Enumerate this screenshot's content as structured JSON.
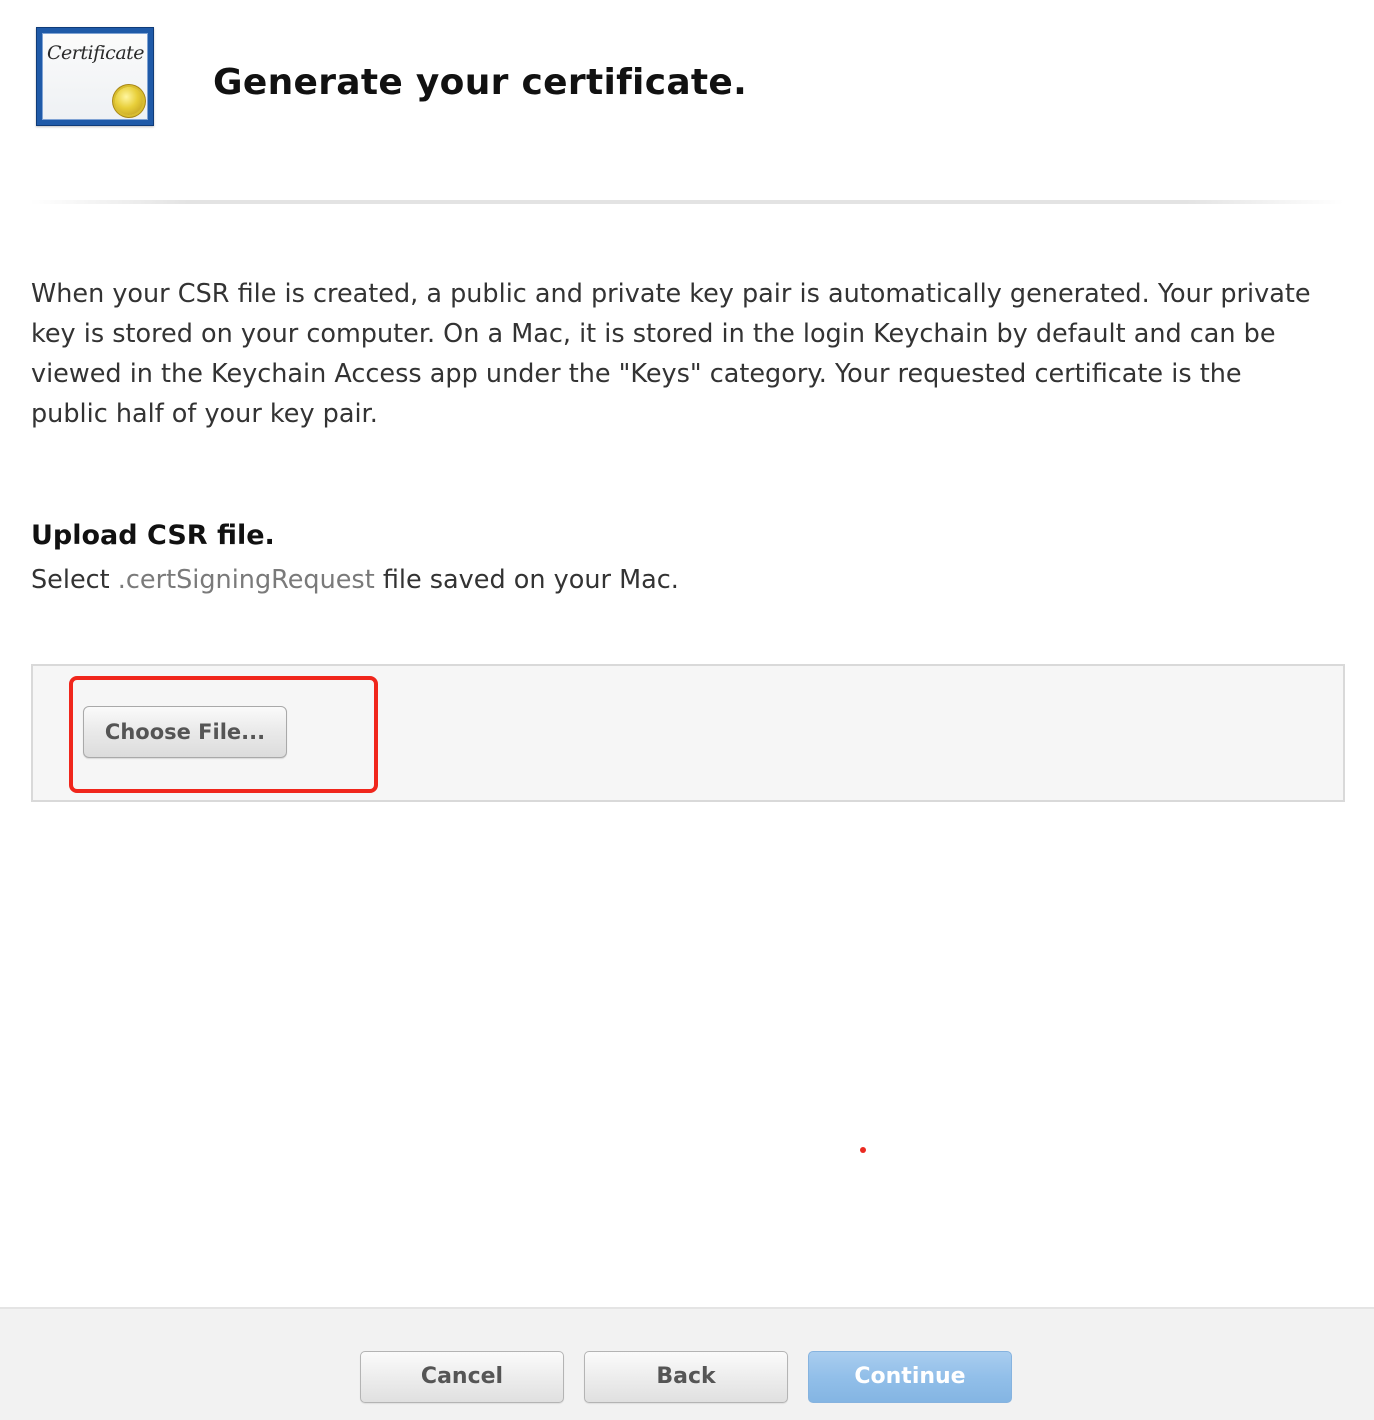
{
  "header": {
    "icon_name": "certificate-icon",
    "icon_text": "Certificate",
    "title": "Generate your certificate."
  },
  "description": "When your CSR file is created, a public and private key pair is automatically generated. Your private key is stored on your computer. On a Mac, it is stored in the login Keychain by default and can be viewed in the Keychain Access app under the \"Keys\" category. Your requested certificate is the public half of your key pair.",
  "upload": {
    "heading": "Upload CSR file.",
    "sub_prefix": "Select",
    "sub_extension": ".certSigningRequest",
    "sub_suffix": "file saved on your Mac.",
    "choose_file_label": "Choose File..."
  },
  "footer": {
    "cancel_label": "Cancel",
    "back_label": "Back",
    "continue_label": "Continue"
  },
  "colors": {
    "highlight": "#f0261c",
    "primary_button": "#92bfe9",
    "footer_bg": "#f2f2f2"
  }
}
